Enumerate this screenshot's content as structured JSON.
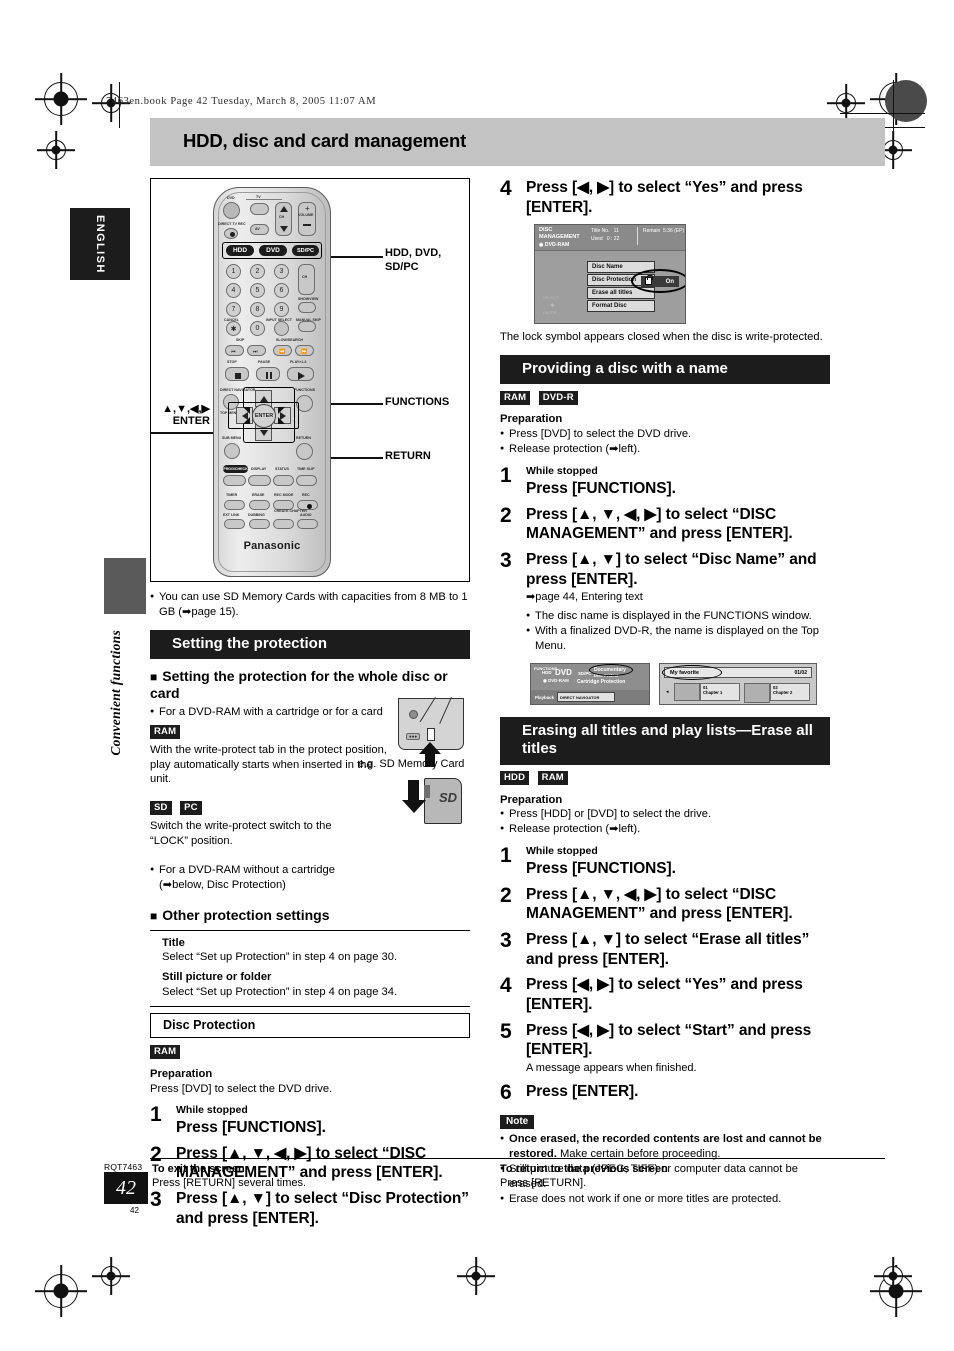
{
  "header": {
    "file_line": "7463en.book  Page 42  Tuesday, March 8, 2005  11:07 AM",
    "title": "HDD, disc and card management"
  },
  "side_tabs": {
    "language": "ENGLISH",
    "section": "Convenient functions"
  },
  "remote": {
    "brand": "Panasonic",
    "power_label": "DVD",
    "tv_label": "TV",
    "direct_tv_rec": "DIRECT TV REC",
    "av_label": "AV",
    "ch_label": "CH",
    "volume_label": "VOLUME",
    "source_buttons": [
      "HDD",
      "DVD",
      "SD/PC"
    ],
    "numbers": [
      "1",
      "2",
      "3",
      "4",
      "5",
      "6",
      "7",
      "8",
      "9",
      "✱",
      "0"
    ],
    "num_sublabels": [
      "CANCEL",
      "INPUT SELECT",
      "SHOWVIEW",
      "MANUAL SKIP"
    ],
    "skip_label": "SKIP",
    "slowsearch_label": "SLOW/SEARCH",
    "stop_label": "STOP",
    "pause_label": "PAUSE",
    "play_label": "PLAY×1.3",
    "direct_navigator": "DIRECT NAVIGATOR",
    "top_menu": "TOP MENU",
    "functions": "FUNCTIONS",
    "sub_menu": "SUB MENU",
    "return": "RETURN",
    "enter": "ENTER",
    "row_labels_1": [
      "PROG/CHECK",
      "DISPLAY",
      "STATUS",
      "TIME SLIP"
    ],
    "row_labels_2": [
      "TIMER",
      "ERASE",
      "REC MODE",
      "REC"
    ],
    "row_labels_3": [
      "EXT LINK",
      "DUBBING",
      "CREATE CHAPTER",
      "AUDIO"
    ]
  },
  "callouts": {
    "sources": "HDD, DVD,\nSD/PC",
    "functions": "FUNCTIONS",
    "return": "RETURN",
    "dpad_arrows": "▲,▼,◀,▶",
    "dpad_enter": "ENTER"
  },
  "left_column": {
    "sd_note": "You can use SD Memory Cards with capacities from 8 MB to 1 GB (➡page 15).",
    "section_setting_protection": "Setting the protection",
    "sub_whole_disc": "Setting the protection for the whole disc or card",
    "bullet_cartridge": "For a DVD-RAM with a cartridge or for a card",
    "badge_ram": "RAM",
    "ram_text": "With the write-protect tab in the protect position, play automatically starts when inserted in the unit.",
    "badge_sd": "SD",
    "badge_pc": "PC",
    "sd_text": "Switch the write-protect switch to the “LOCK” position.",
    "eg_caption": "e.g. SD Memory Card",
    "bullet_no_cartridge": "For a DVD-RAM without a cartridge (➡below, Disc Protection)",
    "sub_other_protection": "Other protection settings",
    "title_label": "Title",
    "title_text": "Select “Set up Protection” in step 4 on page 30.",
    "still_label": "Still picture or folder",
    "still_text": "Select “Set up Protection” in step 4 on page 34.",
    "box_disc_protection": "Disc Protection",
    "preparation_label": "Preparation",
    "preparation_text": "Press [DVD] to select the DVD drive.",
    "steps": [
      {
        "num": "1",
        "cond": "While stopped",
        "main": "Press [FUNCTIONS]."
      },
      {
        "num": "2",
        "cond": "",
        "main": "Press [▲, ▼, ◀, ▶] to select “DISC MANAGEMENT” and press [ENTER]."
      },
      {
        "num": "3",
        "cond": "",
        "main": "Press [▲, ▼] to select “Disc Protection” and press [ENTER]."
      }
    ]
  },
  "right_column": {
    "step4": {
      "num": "4",
      "main": "Press [◀, ▶] to select “Yes” and press [ENTER]."
    },
    "tv_screen": {
      "title_line1": "DISC",
      "title_line2": "MANAGEMENT",
      "disc_type": "DVD-RAM",
      "title_no_label": "Title No.",
      "title_no_value": "11",
      "used_label": "Used",
      "used_value": "0 : 22",
      "remain_label": "Remain",
      "remain_value": "5:36 (EP)",
      "menu_items": [
        "Disc Name",
        "Disc Protection",
        "Erase all titles",
        "Format Disc"
      ],
      "value": "On",
      "pad_select": "SELECT",
      "pad_enter": "ENTER",
      "pad_return": "RETURN"
    },
    "lock_note": "The lock symbol appears closed when the disc is write-protected.",
    "section_naming": "Providing a disc with a name",
    "badges_naming": [
      "RAM",
      "DVD-R"
    ],
    "prep_label": "Preparation",
    "prep_bullets_naming": [
      "Press [DVD] to select the DVD drive.",
      "Release protection (➡left)."
    ],
    "steps_naming": [
      {
        "num": "1",
        "cond": "While stopped",
        "main": "Press [FUNCTIONS].",
        "sub": ""
      },
      {
        "num": "2",
        "cond": "",
        "main": "Press [▲, ▼, ◀, ▶] to select “DISC MANAGEMENT” and press [ENTER].",
        "sub": ""
      },
      {
        "num": "3",
        "cond": "",
        "main": "Press [▲, ▼] to select “Disc Name” and press [ENTER].",
        "sub": "➡page 44, Entering text"
      }
    ],
    "naming_bullets": [
      "The disc name is displayed in the FUNCTIONS window.",
      "With a finalized DVD-R, the name is displayed on the Top Menu."
    ],
    "mock_functions": {
      "label": "FUNCTIONS",
      "hdd": "HDD",
      "dvd": "DVD",
      "sdpc": "SD/PC",
      "disc_type": "DVD-RAM",
      "disc_name": "Documentary",
      "disc_protect": "Disc Protect",
      "cartridge_protect": "Cartridge Protection",
      "playback": "Playback",
      "direct_navigator": "DIRECT NAVIGATOR"
    },
    "mock_topmenu": {
      "name": "My favorite",
      "page": "01/02",
      "item1_no": "01",
      "item1": "Chapter 1",
      "item2_no": "02",
      "item2": "Chapter 2"
    },
    "section_erasing": "Erasing all titles and play lists—Erase all titles",
    "badges_erasing": [
      "HDD",
      "RAM"
    ],
    "prep_bullets_erasing": [
      "Press [HDD] or [DVD] to select the drive.",
      "Release protection (➡left)."
    ],
    "steps_erasing": [
      {
        "num": "1",
        "cond": "While stopped",
        "main": "Press [FUNCTIONS].",
        "sub": ""
      },
      {
        "num": "2",
        "cond": "",
        "main": "Press [▲, ▼, ◀, ▶] to select “DISC MANAGEMENT” and press [ENTER].",
        "sub": ""
      },
      {
        "num": "3",
        "cond": "",
        "main": "Press [▲, ▼] to select “Erase all titles” and press [ENTER].",
        "sub": ""
      },
      {
        "num": "4",
        "cond": "",
        "main": "Press [◀, ▶] to select “Yes” and press [ENTER].",
        "sub": ""
      },
      {
        "num": "5",
        "cond": "",
        "main": "Press [◀, ▶] to select “Start” and press [ENTER].",
        "sub": "A message appears when finished."
      },
      {
        "num": "6",
        "cond": "",
        "main": "Press [ENTER].",
        "sub": ""
      }
    ],
    "note_label": "Note",
    "note_bold": "Once erased, the recorded contents are lost and cannot be restored.",
    "note_rest": " Make certain before proceeding.",
    "note_bullets": [
      "Still picture data (JPEG, TIFF) or computer data cannot be erased.",
      "Erase does not work if one or more titles are protected."
    ]
  },
  "footer": {
    "rqt": "RQT7463",
    "page": "42",
    "page_small": "42",
    "exit_title": "To exit the screen",
    "exit_text": "Press [RETURN] several times.",
    "return_title": "To return to the previous screen",
    "return_text": "Press [RETURN]."
  }
}
